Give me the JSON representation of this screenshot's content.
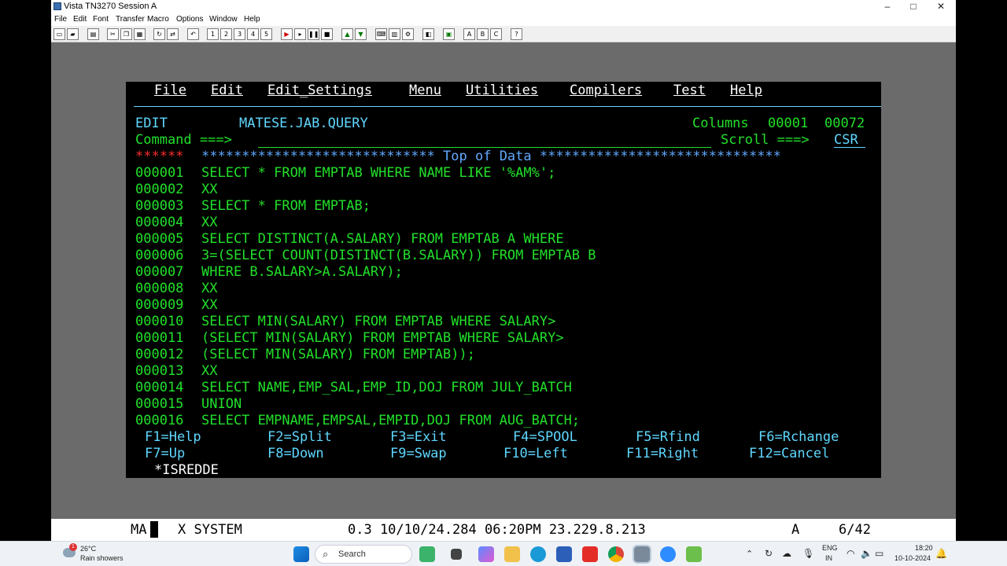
{
  "window": {
    "title": "Vista TN3270 Session A",
    "controls": {
      "minimize": "–",
      "maximize": "□",
      "close": "✕"
    }
  },
  "menubar": [
    "File",
    "Edit",
    "Font",
    "Transfer",
    "Macro",
    "Options",
    "Window",
    "Help"
  ],
  "toolbar": {
    "macro_buttons": [
      "1",
      "2",
      "3",
      "4",
      "5"
    ],
    "letter_buttons": [
      "A",
      "B",
      "C"
    ],
    "help_button": "?"
  },
  "terminal": {
    "menu": [
      "File",
      "Edit",
      "Edit_Settings",
      "Menu",
      "Utilities",
      "Compilers",
      "Test",
      "Help"
    ],
    "mode": "EDIT",
    "dataset": "MATESE.JAB.QUERY",
    "columns_label": "Columns",
    "columns_from": "00001",
    "columns_to": "00072",
    "command_label": "Command ===>",
    "command_value": "",
    "scroll_label": "Scroll ===>",
    "scroll_value": "CSR",
    "top_marker": "******",
    "top_banner": "***************************** Top of Data ******************************",
    "lines": [
      {
        "num": "000001",
        "text": "SELECT * FROM EMPTAB WHERE NAME LIKE '%AM%';"
      },
      {
        "num": "000002",
        "text": "XX"
      },
      {
        "num": "000003",
        "text": "SELECT * FROM EMPTAB;"
      },
      {
        "num": "000004",
        "text": "XX"
      },
      {
        "num": "000005",
        "text": "SELECT DISTINCT(A.SALARY) FROM EMPTAB A WHERE"
      },
      {
        "num": "000006",
        "text": "3=(SELECT COUNT(DISTINCT(B.SALARY)) FROM EMPTAB B"
      },
      {
        "num": "000007",
        "text": "WHERE B.SALARY>A.SALARY);"
      },
      {
        "num": "000008",
        "text": "XX"
      },
      {
        "num": "000009",
        "text": "XX"
      },
      {
        "num": "000010",
        "text": "SELECT MIN(SALARY) FROM EMPTAB WHERE SALARY>"
      },
      {
        "num": "000011",
        "text": "(SELECT MIN(SALARY) FROM EMPTAB WHERE SALARY>"
      },
      {
        "num": "000012",
        "text": "(SELECT MIN(SALARY) FROM EMPTAB));"
      },
      {
        "num": "000013",
        "text": "XX"
      },
      {
        "num": "000014",
        "text": "SELECT NAME,EMP_SAL,EMP_ID,DOJ FROM JULY_BATCH"
      },
      {
        "num": "000015",
        "text": "UNION"
      },
      {
        "num": "000016",
        "text": "SELECT EMPNAME,EMPSAL,EMPID,DOJ FROM AUG_BATCH;"
      }
    ],
    "fkeys_row1": [
      "F1=Help",
      "F2=Split",
      "F3=Exit",
      "F4=SPOOL",
      "F5=Rfind",
      "F6=Rchange"
    ],
    "fkeys_row2": [
      "F7=Up",
      "F8=Down",
      "F9=Swap",
      "F10=Left",
      "F11=Right",
      "F12=Cancel"
    ],
    "panel_id": "*ISREDDE"
  },
  "statusbar": {
    "ma": "MA",
    "x_system": "X SYSTEM",
    "info": "0.3 10/10/24.284 06:20PM 23.229.8.213",
    "a": "A",
    "position": "6/42"
  },
  "taskbar": {
    "weather_temp": "26°C",
    "weather_desc": "Rain showers",
    "weather_badge": "1",
    "search_placeholder": "Search",
    "lang_top": "ENG",
    "lang_bottom": "IN",
    "time": "18:20",
    "date": "10-10-2024"
  }
}
